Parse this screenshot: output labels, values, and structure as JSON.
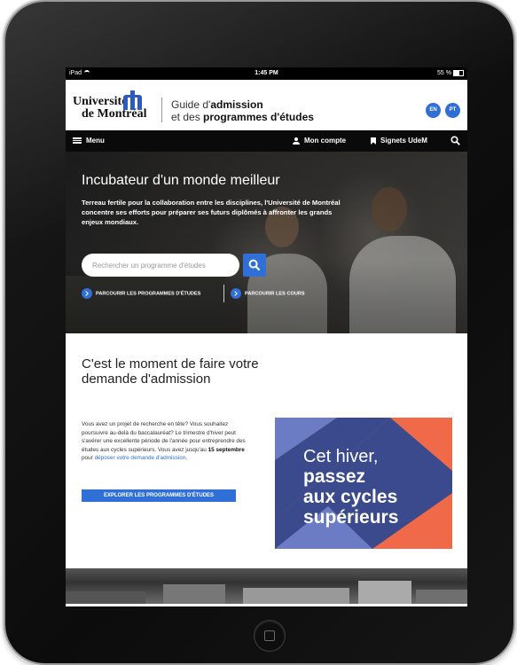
{
  "status_bar": {
    "device": "iPad",
    "time": "1:45 PM",
    "battery": "55 %"
  },
  "header": {
    "logo_line1": "Université",
    "logo_line2": "de Montréal",
    "guide_line1_prefix": "Guide d'",
    "guide_line1_bold": "admission",
    "guide_line2_prefix": "et des ",
    "guide_line2_bold": "programmes d'études",
    "lang_en": "EN",
    "lang_pt": "PT"
  },
  "nav": {
    "menu_label": "Menu",
    "account_label": "Mon compte",
    "bookmarks_label": "Signets UdeM"
  },
  "hero": {
    "title": "Incubateur d'un monde meilleur",
    "text": "Terreau fertile pour la collaboration entre les disciplines, l'Université de Montréal concentre ses efforts pour préparer ses futurs diplômés à affronter les grands enjeux mondiaux.",
    "search_placeholder": "Rechercher un programme d'études",
    "browse_programs": "PARCOURIR LES PROGRAMMES D'ÉTUDES",
    "browse_courses": "PARCOURIR LES COURS"
  },
  "admission": {
    "title": "C'est le moment de faire votre demande d'admission",
    "text_part1": "Vous avez un projet de recherche en tête? Vous souhaitez poursuivre au-delà du baccalauréat? Le trimestre d'hiver peut s'avérer une excellente période de l'année pour entreprendre des études aux cycles supérieurs. Vous avez jusqu'au ",
    "text_bold": "15 septembre",
    "text_part2": " pour ",
    "text_link": "déposer votre demande d'admission",
    "text_end": ".",
    "button_label": "EXPLORER LES PROGRAMMES D'ÉTUDES"
  },
  "promo": {
    "line1": "Cet hiver,",
    "line2": "passez",
    "line3": "aux cycles",
    "line4": "supérieurs",
    "colors": {
      "coral": "#f06a4a",
      "navy": "#3b4a8c",
      "periwinkle": "#6b7cc4"
    }
  },
  "colors": {
    "accent": "#2f6fd6",
    "nav_bg": "#0a0a0a"
  }
}
